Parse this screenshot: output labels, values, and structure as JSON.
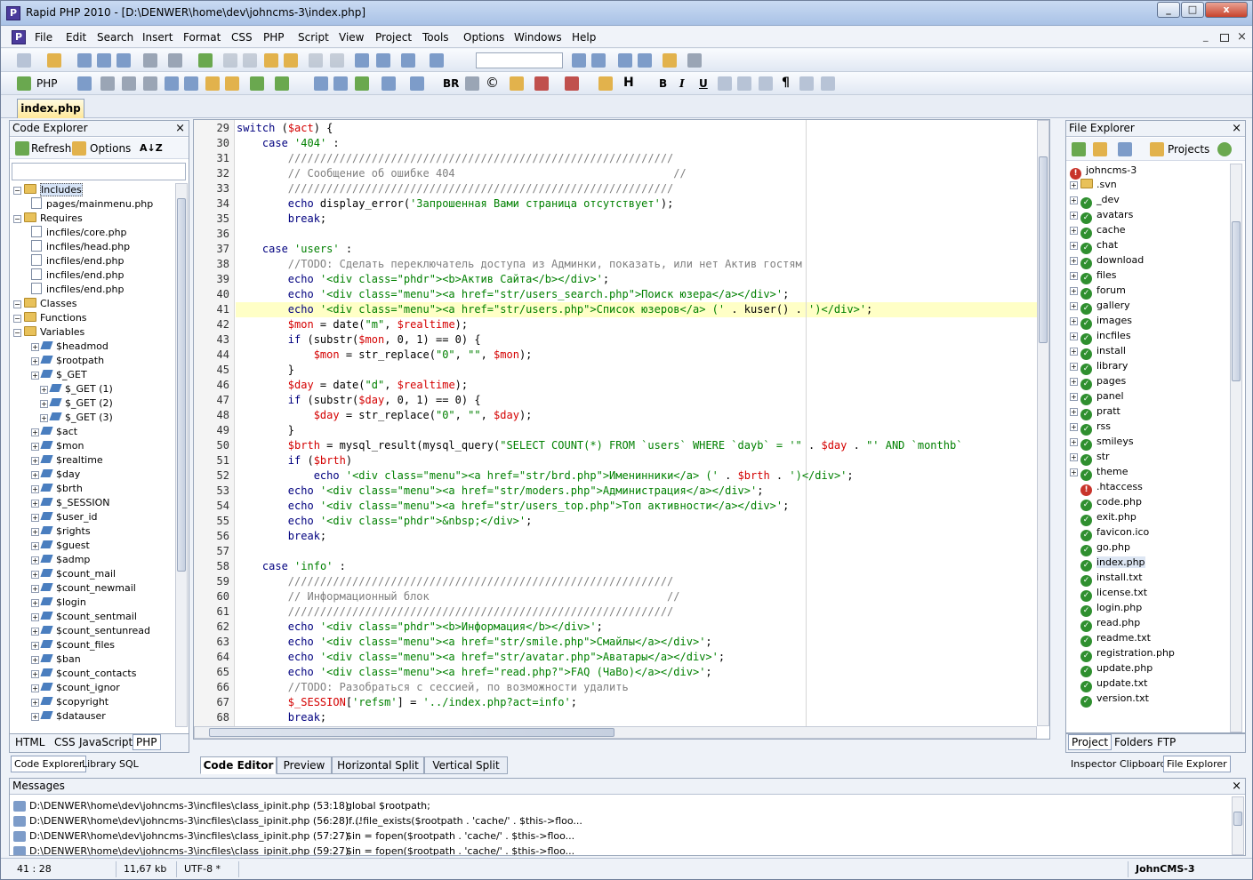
{
  "window": {
    "title": "Rapid PHP 2010 - [D:\\DENWER\\home\\dev\\johncms-3\\index.php]",
    "app_icon": "P",
    "min": "_",
    "max": "□",
    "close": "x"
  },
  "menu": [
    "File",
    "Edit",
    "Search",
    "Insert",
    "Format",
    "CSS",
    "PHP",
    "Script",
    "View",
    "Project",
    "Tools",
    "Options",
    "Windows",
    "Help"
  ],
  "menu_right": [
    "_",
    "×"
  ],
  "toolbar2": {
    "php_label": "PHP",
    "br_label": "BR",
    "h_label": "H",
    "b": "B",
    "i": "I",
    "u": "U",
    "para": "¶",
    "copy": "©"
  },
  "doc_tab": "index.php",
  "code_explorer": {
    "title": "Code Explorer",
    "refresh": "Refresh",
    "options": "Options",
    "sort": "A↓Z",
    "tree": [
      {
        "t": "Includes",
        "k": "folder",
        "d": 0
      },
      {
        "t": "pages/mainmenu.php",
        "k": "file",
        "d": 2
      },
      {
        "t": "Requires",
        "k": "folder",
        "d": 0
      },
      {
        "t": "incfiles/core.php",
        "k": "file",
        "d": 2
      },
      {
        "t": "incfiles/head.php",
        "k": "file",
        "d": 2
      },
      {
        "t": "incfiles/end.php",
        "k": "file",
        "d": 2
      },
      {
        "t": "incfiles/end.php",
        "k": "file",
        "d": 2
      },
      {
        "t": "incfiles/end.php",
        "k": "file",
        "d": 2
      },
      {
        "t": "Classes",
        "k": "folder",
        "d": 0
      },
      {
        "t": "Functions",
        "k": "folder",
        "d": 0
      },
      {
        "t": "Variables",
        "k": "folder",
        "d": 0
      },
      {
        "t": "$headmod",
        "k": "var",
        "d": 2
      },
      {
        "t": "$rootpath",
        "k": "var",
        "d": 2
      },
      {
        "t": "$_GET",
        "k": "var",
        "d": 2
      },
      {
        "t": "$_GET (1)",
        "k": "var",
        "d": 3
      },
      {
        "t": "$_GET (2)",
        "k": "var",
        "d": 3
      },
      {
        "t": "$_GET (3)",
        "k": "var",
        "d": 3
      },
      {
        "t": "$act",
        "k": "var",
        "d": 2
      },
      {
        "t": "$mon",
        "k": "var",
        "d": 2
      },
      {
        "t": "$realtime",
        "k": "var",
        "d": 2
      },
      {
        "t": "$day",
        "k": "var",
        "d": 2
      },
      {
        "t": "$brth",
        "k": "var",
        "d": 2
      },
      {
        "t": "$_SESSION",
        "k": "var",
        "d": 2
      },
      {
        "t": "$user_id",
        "k": "var",
        "d": 2
      },
      {
        "t": "$rights",
        "k": "var",
        "d": 2
      },
      {
        "t": "$guest",
        "k": "var",
        "d": 2
      },
      {
        "t": "$admp",
        "k": "var",
        "d": 2
      },
      {
        "t": "$count_mail",
        "k": "var",
        "d": 2
      },
      {
        "t": "$count_newmail",
        "k": "var",
        "d": 2
      },
      {
        "t": "$login",
        "k": "var",
        "d": 2
      },
      {
        "t": "$count_sentmail",
        "k": "var",
        "d": 2
      },
      {
        "t": "$count_sentunread",
        "k": "var",
        "d": 2
      },
      {
        "t": "$count_files",
        "k": "var",
        "d": 2
      },
      {
        "t": "$ban",
        "k": "var",
        "d": 2
      },
      {
        "t": "$count_contacts",
        "k": "var",
        "d": 2
      },
      {
        "t": "$count_ignor",
        "k": "var",
        "d": 2
      },
      {
        "t": "$copyright",
        "k": "var",
        "d": 2
      },
      {
        "t": "$datauser",
        "k": "var",
        "d": 2
      }
    ],
    "lang_tabs": [
      "HTML",
      "CSS",
      "JavaScript",
      "PHP"
    ],
    "bottom_tabs": [
      "Code Explorer",
      "Library",
      "SQL"
    ]
  },
  "editor": {
    "lines": [
      {
        "n": "29",
        "html": "<span class='kw'>switch</span> (<span class='v'>$act</span>) {"
      },
      {
        "n": "30",
        "html": "    <span class='kw'>case</span> <span class='s'>'404'</span> :"
      },
      {
        "n": "31",
        "html": "        <span class='cm'>////////////////////////////////////////////////////////////</span>"
      },
      {
        "n": "32",
        "html": "        <span class='cm'>// Сообщение об ошибке 404                                  //</span>"
      },
      {
        "n": "33",
        "html": "        <span class='cm'>////////////////////////////////////////////////////////////</span>"
      },
      {
        "n": "34",
        "html": "        <span class='kw'>echo</span> display_error(<span class='s'>'Запрошенная Вами страница отсутствует'</span>);"
      },
      {
        "n": "35",
        "html": "        <span class='kw'>break</span>;"
      },
      {
        "n": "36",
        "html": ""
      },
      {
        "n": "37",
        "html": "    <span class='kw'>case</span> <span class='s'>'users'</span> :"
      },
      {
        "n": "38",
        "html": "        <span class='cm'>//TODO: Сделать переключатель доступа из Админки, показать, или нет Актив гостям</span>"
      },
      {
        "n": "39",
        "html": "        <span class='kw'>echo</span> <span class='s'>'&lt;div class=\"phdr\"&gt;&lt;b&gt;Актив Сайта&lt;/b&gt;&lt;/div&gt;'</span>;"
      },
      {
        "n": "40",
        "html": "        <span class='kw'>echo</span> <span class='s'>'&lt;div class=\"menu\"&gt;&lt;a href=\"str/users_search.php\"&gt;Поиск юзера&lt;/a&gt;&lt;/div&gt;'</span>;"
      },
      {
        "n": "41",
        "html": "        <span class='kw'>echo</span> <span class='s'>'&lt;div class=\"menu\"&gt;&lt;a href=\"str/users.php\"&gt;Список юзеров&lt;/a&gt; ('</span> . kuser() . <span class='s'>')&lt;/div&gt;'</span>;"
      },
      {
        "n": "42",
        "html": "        <span class='v'>$mon</span> = date(<span class='s'>\"m\"</span>, <span class='v'>$realtime</span>);"
      },
      {
        "n": "43",
        "html": "        <span class='kw'>if</span> (substr(<span class='v'>$mon</span>, 0, 1) == 0) {"
      },
      {
        "n": "44",
        "html": "            <span class='v'>$mon</span> = str_replace(<span class='s'>\"0\"</span>, <span class='s'>\"\"</span>, <span class='v'>$mon</span>);"
      },
      {
        "n": "45",
        "html": "        }"
      },
      {
        "n": "46",
        "html": "        <span class='v'>$day</span> = date(<span class='s'>\"d\"</span>, <span class='v'>$realtime</span>);"
      },
      {
        "n": "47",
        "html": "        <span class='kw'>if</span> (substr(<span class='v'>$day</span>, 0, 1) == 0) {"
      },
      {
        "n": "48",
        "html": "            <span class='v'>$day</span> = str_replace(<span class='s'>\"0\"</span>, <span class='s'>\"\"</span>, <span class='v'>$day</span>);"
      },
      {
        "n": "49",
        "html": "        }"
      },
      {
        "n": "50",
        "html": "        <span class='v'>$brth</span> = mysql_result(mysql_query(<span class='s'>\"SELECT COUNT(*) FROM `users` WHERE `dayb` = '\"</span> . <span class='v'>$day</span> . <span class='s'>\"' AND `monthb`</span>"
      },
      {
        "n": "51",
        "html": "        <span class='kw'>if</span> (<span class='v'>$brth</span>)"
      },
      {
        "n": "52",
        "html": "            <span class='kw'>echo</span> <span class='s'>'&lt;div class=\"menu\"&gt;&lt;a href=\"str/brd.php\"&gt;Именинники&lt;/a&gt; ('</span> . <span class='v'>$brth</span> . <span class='s'>')&lt;/div&gt;'</span>;"
      },
      {
        "n": "53",
        "html": "        <span class='kw'>echo</span> <span class='s'>'&lt;div class=\"menu\"&gt;&lt;a href=\"str/moders.php\"&gt;Администрация&lt;/a&gt;&lt;/div&gt;'</span>;"
      },
      {
        "n": "54",
        "html": "        <span class='kw'>echo</span> <span class='s'>'&lt;div class=\"menu\"&gt;&lt;a href=\"str/users_top.php\"&gt;Топ активности&lt;/a&gt;&lt;/div&gt;'</span>;"
      },
      {
        "n": "55",
        "html": "        <span class='kw'>echo</span> <span class='s'>'&lt;div class=\"phdr\"&gt;&amp;nbsp;&lt;/div&gt;'</span>;"
      },
      {
        "n": "56",
        "html": "        <span class='kw'>break</span>;"
      },
      {
        "n": "57",
        "html": ""
      },
      {
        "n": "58",
        "html": "    <span class='kw'>case</span> <span class='s'>'info'</span> :"
      },
      {
        "n": "59",
        "html": "        <span class='cm'>////////////////////////////////////////////////////////////</span>"
      },
      {
        "n": "60",
        "html": "        <span class='cm'>// Информационный блок                                     //</span>"
      },
      {
        "n": "61",
        "html": "        <span class='cm'>////////////////////////////////////////////////////////////</span>"
      },
      {
        "n": "62",
        "html": "        <span class='kw'>echo</span> <span class='s'>'&lt;div class=\"phdr\"&gt;&lt;b&gt;Информация&lt;/b&gt;&lt;/div&gt;'</span>;"
      },
      {
        "n": "63",
        "html": "        <span class='kw'>echo</span> <span class='s'>'&lt;div class=\"menu\"&gt;&lt;a href=\"str/smile.php\"&gt;Смайлы&lt;/a&gt;&lt;/div&gt;'</span>;"
      },
      {
        "n": "64",
        "html": "        <span class='kw'>echo</span> <span class='s'>'&lt;div class=\"menu\"&gt;&lt;a href=\"str/avatar.php\"&gt;Аватары&lt;/a&gt;&lt;/div&gt;'</span>;"
      },
      {
        "n": "65",
        "html": "        <span class='kw'>echo</span> <span class='s'>'&lt;div class=\"menu\"&gt;&lt;a href=\"read.php?\"&gt;FAQ (ЧаВо)&lt;/a&gt;&lt;/div&gt;'</span>;"
      },
      {
        "n": "66",
        "html": "        <span class='cm'>//TODO: Разобраться с сессией, по возможности удалить</span>"
      },
      {
        "n": "67",
        "html": "        <span class='v'>$_SESSION</span>[<span class='s'>'refsm'</span>] = <span class='s'>'../index.php?act=info'</span>;"
      },
      {
        "n": "68",
        "html": "        <span class='kw'>break</span>;"
      },
      {
        "n": "69",
        "html": ""
      }
    ],
    "view_tabs": [
      "Code Editor",
      "Preview",
      "Horizontal Split",
      "Vertical Split"
    ]
  },
  "file_explorer": {
    "title": "File Explorer",
    "projects": "Projects",
    "root": "johncms-3",
    "items": [
      {
        "t": ".svn",
        "k": "folder",
        "s": "none"
      },
      {
        "t": "_dev",
        "k": "folder",
        "s": "ok"
      },
      {
        "t": "avatars",
        "k": "folder",
        "s": "ok"
      },
      {
        "t": "cache",
        "k": "folder",
        "s": "ok"
      },
      {
        "t": "chat",
        "k": "folder",
        "s": "ok"
      },
      {
        "t": "download",
        "k": "folder",
        "s": "ok"
      },
      {
        "t": "files",
        "k": "folder",
        "s": "ok"
      },
      {
        "t": "forum",
        "k": "folder",
        "s": "ok"
      },
      {
        "t": "gallery",
        "k": "folder",
        "s": "ok"
      },
      {
        "t": "images",
        "k": "folder",
        "s": "ok"
      },
      {
        "t": "incfiles",
        "k": "folder",
        "s": "ok"
      },
      {
        "t": "install",
        "k": "folder",
        "s": "ok"
      },
      {
        "t": "library",
        "k": "folder",
        "s": "ok"
      },
      {
        "t": "pages",
        "k": "folder",
        "s": "ok"
      },
      {
        "t": "panel",
        "k": "folder",
        "s": "ok"
      },
      {
        "t": "pratt",
        "k": "folder",
        "s": "ok"
      },
      {
        "t": "rss",
        "k": "folder",
        "s": "ok"
      },
      {
        "t": "smileys",
        "k": "folder",
        "s": "ok"
      },
      {
        "t": "str",
        "k": "folder",
        "s": "ok"
      },
      {
        "t": "theme",
        "k": "folder",
        "s": "ok"
      },
      {
        "t": ".htaccess",
        "k": "file",
        "s": "bang"
      },
      {
        "t": "code.php",
        "k": "file",
        "s": "ok"
      },
      {
        "t": "exit.php",
        "k": "file",
        "s": "ok"
      },
      {
        "t": "favicon.ico",
        "k": "file",
        "s": "ok"
      },
      {
        "t": "go.php",
        "k": "file",
        "s": "ok"
      },
      {
        "t": "index.php",
        "k": "file",
        "s": "ok"
      },
      {
        "t": "install.txt",
        "k": "file",
        "s": "ok"
      },
      {
        "t": "license.txt",
        "k": "file",
        "s": "ok"
      },
      {
        "t": "login.php",
        "k": "file",
        "s": "ok"
      },
      {
        "t": "read.php",
        "k": "file",
        "s": "ok"
      },
      {
        "t": "readme.txt",
        "k": "file",
        "s": "ok"
      },
      {
        "t": "registration.php",
        "k": "file",
        "s": "ok"
      },
      {
        "t": "update.php",
        "k": "file",
        "s": "ok"
      },
      {
        "t": "update.txt",
        "k": "file",
        "s": "ok"
      },
      {
        "t": "version.txt",
        "k": "file",
        "s": "ok"
      }
    ],
    "tabs_top": [
      "Project",
      "Folders",
      "FTP"
    ],
    "tabs_bottom": [
      "Inspector",
      "Clipboard",
      "File Explorer"
    ]
  },
  "messages": {
    "title": "Messages",
    "rows": [
      {
        "path": "D:\\DENWER\\home\\dev\\johncms-3\\incfiles\\class_ipinit.php (53:18)",
        "text": "global $rootpath;"
      },
      {
        "path": "D:\\DENWER\\home\\dev\\johncms-3\\incfiles\\class_ipinit.php (56:28) ...",
        "text": "if (!file_exists($rootpath . 'cache/' . $this->floo..."
      },
      {
        "path": "D:\\DENWER\\home\\dev\\johncms-3\\incfiles\\class_ipinit.php (57:27)",
        "text": "$in = fopen($rootpath . 'cache/' . $this->floo..."
      },
      {
        "path": "D:\\DENWER\\home\\dev\\johncms-3\\incfiles\\class_ipinit.php (59:27)",
        "text": "$in = fopen($rootpath . 'cache/' . $this->floo..."
      }
    ]
  },
  "status": {
    "pos": "41 : 28",
    "size": "11,67 kb",
    "enc": "UTF-8 *",
    "project": "JohnCMS-3"
  }
}
